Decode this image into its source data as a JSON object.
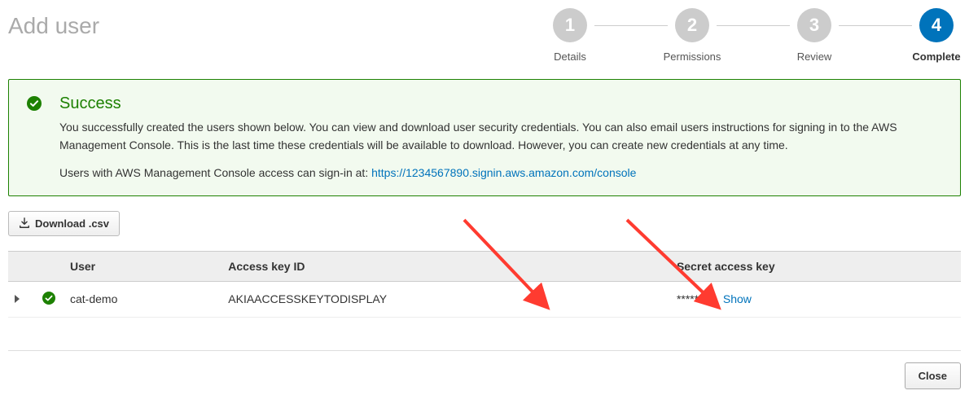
{
  "page_title": "Add user",
  "stepper": {
    "steps": [
      {
        "num": "1",
        "label": "Details"
      },
      {
        "num": "2",
        "label": "Permissions"
      },
      {
        "num": "3",
        "label": "Review"
      },
      {
        "num": "4",
        "label": "Complete"
      }
    ],
    "active_index": 3
  },
  "success": {
    "title": "Success",
    "body": "You successfully created the users shown below. You can view and download user security credentials. You can also email users instructions for signing in to the AWS Management Console. This is the last time these credentials will be available to download. However, you can create new credentials at any time.",
    "signin_prefix": "Users with AWS Management Console access can sign-in at: ",
    "signin_url": "https://1234567890.signin.aws.amazon.com/console"
  },
  "download_label": "Download .csv",
  "table": {
    "headers": {
      "user": "User",
      "access_key": "Access key ID",
      "secret": "Secret access key"
    },
    "rows": [
      {
        "user": "cat-demo",
        "access_key": "AKIAACCESSKEYTODISPLAY",
        "secret_masked": "*********",
        "show_label": "Show"
      }
    ]
  },
  "close_label": "Close"
}
